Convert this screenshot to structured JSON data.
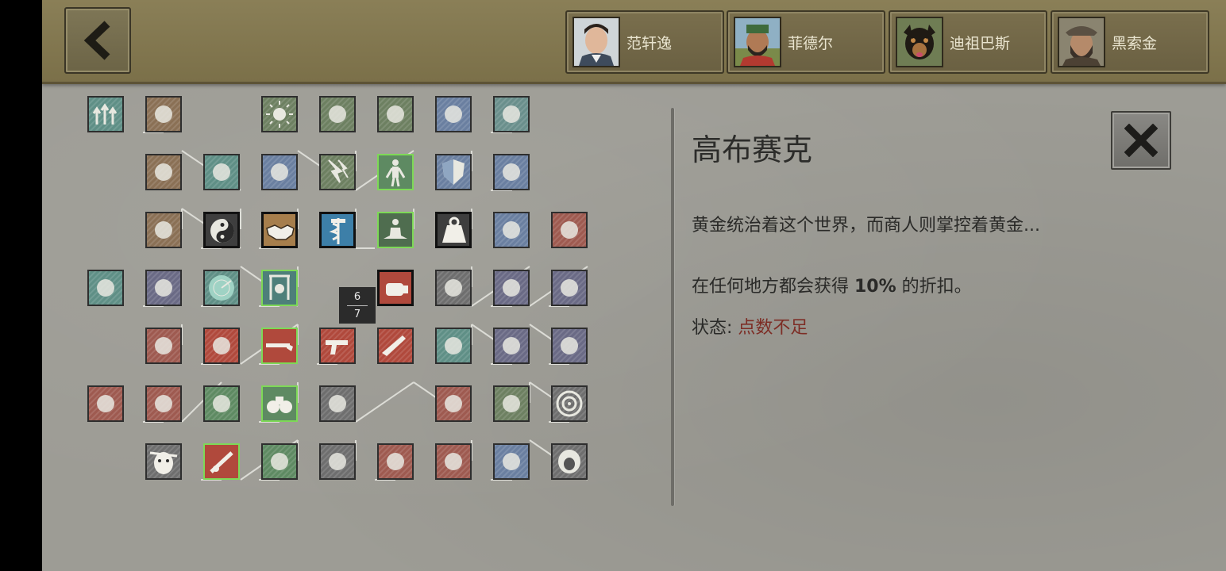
{
  "back_button": {
    "icon": "chevron-left-icon"
  },
  "characters": [
    {
      "name": "范轩逸",
      "portrait": "young-man-portrait"
    },
    {
      "name": "菲德尔",
      "portrait": "bearded-man-cap-portrait"
    },
    {
      "name": "迪祖巴斯",
      "portrait": "dog-portrait"
    },
    {
      "name": "黑索金",
      "portrait": "old-man-hat-portrait"
    }
  ],
  "skill_tree": {
    "points_counter": {
      "current": "6",
      "max": "7"
    },
    "skills": [
      {
        "id": "r0c0",
        "color": "#5f8f86",
        "state": "locked",
        "icon": "arrows-up-icon"
      },
      {
        "id": "r0c1",
        "color": "#8a7055",
        "state": "locked",
        "icon": "map-icon"
      },
      {
        "id": "r0c3",
        "color": "#6d8061",
        "state": "locked",
        "icon": "sun-icon"
      },
      {
        "id": "r0c4",
        "color": "#6d8061",
        "state": "locked",
        "icon": "bottles-icon"
      },
      {
        "id": "r0c5",
        "color": "#6d8061",
        "state": "locked",
        "icon": "drops-icon"
      },
      {
        "id": "r0c6",
        "color": "#6a7fa0",
        "state": "locked",
        "icon": "head-stars-icon"
      },
      {
        "id": "r0c7",
        "color": "#6a8f8c",
        "state": "locked",
        "icon": "fist-armor-icon"
      },
      {
        "id": "r1c1",
        "color": "#8a7055",
        "state": "locked",
        "icon": "scroll-icon"
      },
      {
        "id": "r1c2",
        "color": "#5f8f86",
        "state": "locked",
        "icon": "graduation-cap-icon"
      },
      {
        "id": "r1c3",
        "color": "#6a7fa0",
        "state": "locked",
        "icon": "heart-drop-icon"
      },
      {
        "id": "r1c4",
        "color": "#6d8061",
        "state": "locked",
        "icon": "lightning-icon"
      },
      {
        "id": "r1c5",
        "color": "#5e8a62",
        "state": "highlighted",
        "icon": "body-icon"
      },
      {
        "id": "r1c6",
        "color": "#6a7fa0",
        "state": "locked",
        "icon": "shield-icon"
      },
      {
        "id": "r1c7",
        "color": "#6a7fa0",
        "state": "locked",
        "icon": "wings-icon"
      },
      {
        "id": "r2c1",
        "color": "#8a7055",
        "state": "locked",
        "icon": "coins-icon"
      },
      {
        "id": "r2c2",
        "color": "#3e3e3e",
        "state": "selected",
        "icon": "yin-yang-icon"
      },
      {
        "id": "r2c3",
        "color": "#a67e4c",
        "state": "selected",
        "icon": "handshake-icon"
      },
      {
        "id": "r2c4",
        "color": "#3d7fa8",
        "state": "selected",
        "icon": "caduceus-icon"
      },
      {
        "id": "r2c5",
        "color": "#4f6d4f",
        "state": "highlighted",
        "icon": "meditation-icon"
      },
      {
        "id": "r2c6",
        "color": "#3e3e3e",
        "state": "selected",
        "icon": "weight-icon"
      },
      {
        "id": "r2c7",
        "color": "#6a7fa0",
        "state": "locked",
        "icon": "bicep-icon"
      },
      {
        "id": "r2c8",
        "color": "#9e5a50",
        "state": "locked",
        "icon": "fist-wrap-icon"
      },
      {
        "id": "r3c0",
        "color": "#5f8f86",
        "state": "locked",
        "icon": "hammer-icon"
      },
      {
        "id": "r3c1",
        "color": "#6a6a85",
        "state": "locked",
        "icon": "claw-icon"
      },
      {
        "id": "r3c2",
        "color": "#5f8f86",
        "state": "locked",
        "icon": "radar-icon"
      },
      {
        "id": "r3c3",
        "color": "#4e7f7a",
        "state": "highlighted",
        "icon": "hanging-trap-icon"
      },
      {
        "id": "r3c5",
        "color": "#b0493c",
        "state": "selected",
        "icon": "punch-icon"
      },
      {
        "id": "r3c6",
        "color": "#6e6e6e",
        "state": "locked",
        "icon": "spear-icon"
      },
      {
        "id": "r3c7",
        "color": "#6a6a85",
        "state": "locked",
        "icon": "knife-icon"
      },
      {
        "id": "r3c8",
        "color": "#6a6a85",
        "state": "locked",
        "icon": "figure-icon"
      },
      {
        "id": "r4c1",
        "color": "#9e5a50",
        "state": "locked",
        "icon": "crossbow-icon"
      },
      {
        "id": "r4c2",
        "color": "#b0493c",
        "state": "locked",
        "icon": "grenade-icon"
      },
      {
        "id": "r4c3",
        "color": "#b0493c",
        "state": "highlighted",
        "icon": "shotgun-icon"
      },
      {
        "id": "r4c4",
        "color": "#b0493c",
        "state": "locked",
        "icon": "pistol-icon"
      },
      {
        "id": "r4c5",
        "color": "#b0493c",
        "state": "locked",
        "icon": "rifle-icon"
      },
      {
        "id": "r4c6",
        "color": "#5f8f86",
        "state": "locked",
        "icon": "sneak-icon"
      },
      {
        "id": "r4c7",
        "color": "#6a6a85",
        "state": "locked",
        "icon": "crawl-icon"
      },
      {
        "id": "r4c8",
        "color": "#6a6a85",
        "state": "locked",
        "icon": "ninja-icon"
      },
      {
        "id": "r5c0",
        "color": "#9e5a50",
        "state": "locked",
        "icon": "molotov-icon"
      },
      {
        "id": "r5c1",
        "color": "#9e5a50",
        "state": "locked",
        "icon": "dynamite-icon"
      },
      {
        "id": "r5c2",
        "color": "#5e8a62",
        "state": "locked",
        "icon": "ears-icon"
      },
      {
        "id": "r5c3",
        "color": "#5e8a62",
        "state": "highlighted",
        "icon": "binoculars-icon"
      },
      {
        "id": "r5c4",
        "color": "#6e6e6e",
        "state": "locked",
        "icon": "walker-icon"
      },
      {
        "id": "r5c6",
        "color": "#9e5a50",
        "state": "locked",
        "icon": "bullets-icon"
      },
      {
        "id": "r5c7",
        "color": "#6d8061",
        "state": "locked",
        "icon": "brain-icon"
      },
      {
        "id": "r5c8",
        "color": "#6e6e6e",
        "state": "locked",
        "icon": "target-icon"
      },
      {
        "id": "r6c1",
        "color": "#6e6e6e",
        "state": "locked",
        "icon": "zombie-head-icon"
      },
      {
        "id": "r6c2",
        "color": "#b0493c",
        "state": "highlighted",
        "icon": "mortar-icon"
      },
      {
        "id": "r6c3",
        "color": "#5e8a62",
        "state": "locked",
        "icon": "rat-icon"
      },
      {
        "id": "r6c4",
        "color": "#6e6e6e",
        "state": "locked",
        "icon": "hand-icon"
      },
      {
        "id": "r6c5",
        "color": "#9e5a50",
        "state": "locked",
        "icon": "ammo-icon"
      },
      {
        "id": "r6c6",
        "color": "#9e5a50",
        "state": "locked",
        "icon": "arrows-icon"
      },
      {
        "id": "r6c7",
        "color": "#6a7fa0",
        "state": "locked",
        "icon": "flex-arm-icon"
      },
      {
        "id": "r6c8",
        "color": "#6e6e6e",
        "state": "locked",
        "icon": "roar-icon"
      }
    ]
  },
  "detail": {
    "title": "高布赛克",
    "description": "黄金统治着这个世界，而商人则掌控着黄金...",
    "effect_prefix": "在任何地方都会获得 ",
    "effect_value": "10%",
    "effect_suffix": " 的折扣。",
    "status_label": "状态",
    "status_colon": ": ",
    "status_value": "点数不足",
    "close_icon": "close-x-icon"
  },
  "colors": {
    "topbar": "#8a7f57",
    "background": "#9d9c95",
    "highlight_border": "#7ed957",
    "status_warning": "#7d2d25"
  }
}
